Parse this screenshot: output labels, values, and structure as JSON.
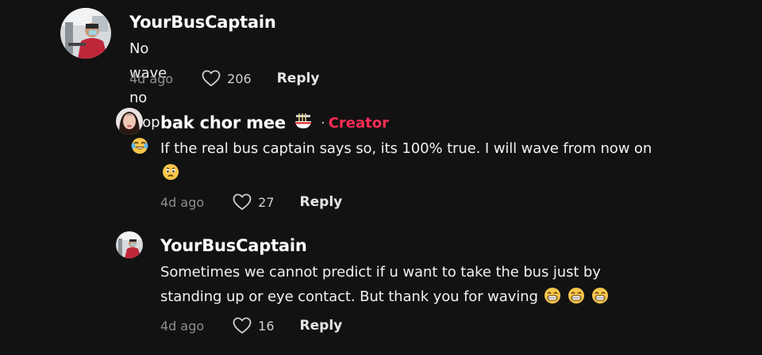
{
  "comments": [
    {
      "username": "YourBusCaptain",
      "text": "No wave no stop",
      "emoji_icon": "tears-of-joy-emoji",
      "time": "4d ago",
      "likes": "206",
      "reply_label": "Reply"
    },
    {
      "username": "bak chor mee",
      "name_icon": "noodle-bowl-emoji",
      "separator": "·",
      "badge": "Creator",
      "text": "If the real bus captain says so, its 100% true. I will wave from now on",
      "emoji_icon": "sad-face-emoji",
      "time": "4d ago",
      "likes": "27",
      "reply_label": "Reply"
    },
    {
      "username": "YourBusCaptain",
      "text": "Sometimes we cannot predict if u want to take the bus just by standing up or eye contact. But thank you for waving",
      "emoji_icon": "grinning-face-emoji",
      "time": "4d ago",
      "likes": "16",
      "reply_label": "Reply"
    }
  ],
  "colors": {
    "background": "#121212",
    "creator_badge": "#fe2c55",
    "meta_text": "#8e8e8e"
  }
}
